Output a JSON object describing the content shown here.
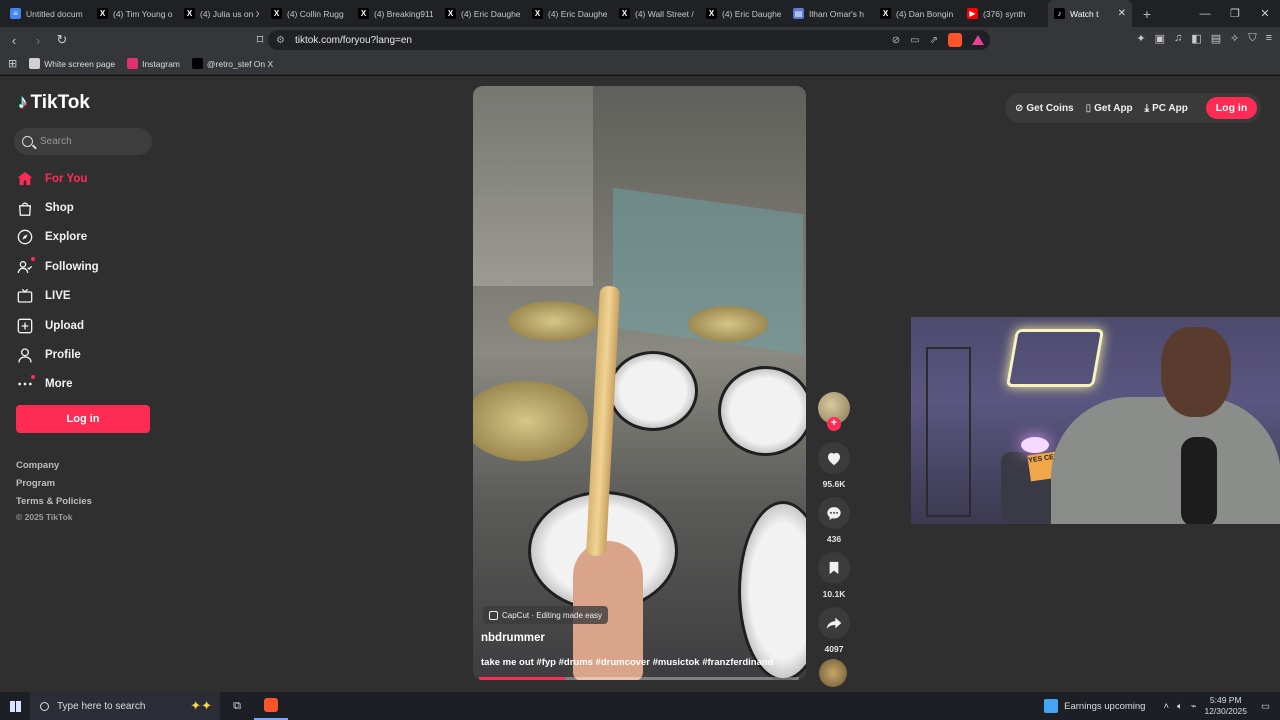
{
  "browser": {
    "tabs": [
      {
        "title": "Untitled docum",
        "icon": "docs-icon",
        "color": "#4285f4",
        "glyph": "≡"
      },
      {
        "title": "(4) Tim Young o",
        "icon": "x-icon",
        "color": "#000000",
        "glyph": "X"
      },
      {
        "title": "(4) Julia us on X",
        "icon": "x-icon",
        "color": "#000000",
        "glyph": "X"
      },
      {
        "title": "(4) Collin Rugg",
        "icon": "x-icon",
        "color": "#000000",
        "glyph": "X"
      },
      {
        "title": "(4) Breaking911",
        "icon": "x-icon",
        "color": "#000000",
        "glyph": "X"
      },
      {
        "title": "(4) Eric Daughe",
        "icon": "x-icon",
        "color": "#000000",
        "glyph": "X"
      },
      {
        "title": "(4) Eric Daughe",
        "icon": "x-icon",
        "color": "#000000",
        "glyph": "X"
      },
      {
        "title": "(4) Wall Street /",
        "icon": "x-icon",
        "color": "#000000",
        "glyph": "X"
      },
      {
        "title": "(4) Eric Daughe",
        "icon": "x-icon",
        "color": "#000000",
        "glyph": "X"
      },
      {
        "title": "Ilhan Omar's h",
        "icon": "news-icon",
        "color": "#5b7bd5",
        "glyph": "▤"
      },
      {
        "title": "(4) Dan Bongin",
        "icon": "x-icon",
        "color": "#000000",
        "glyph": "X"
      },
      {
        "title": "(376) synth",
        "icon": "youtube-icon",
        "color": "#ff0000",
        "glyph": "▶"
      },
      {
        "title": "Watch t",
        "icon": "tiktok-icon",
        "color": "#000000",
        "glyph": "♪",
        "active": true
      }
    ],
    "url": "tiktok.com/foryou?lang=en",
    "bookmarks": [
      {
        "label": "White screen page",
        "icon": "page-icon",
        "color": "#d0d0d0"
      },
      {
        "label": "Instagram",
        "icon": "instagram-icon",
        "color": "#e1306c"
      },
      {
        "label": "@retro_stef On X",
        "icon": "x-icon",
        "color": "#000000"
      }
    ]
  },
  "sidebar": {
    "logo": "TikTok",
    "search_placeholder": "Search",
    "items": [
      {
        "label": "For You",
        "icon": "home-icon",
        "active": true
      },
      {
        "label": "Shop",
        "icon": "shop-icon"
      },
      {
        "label": "Explore",
        "icon": "compass-icon"
      },
      {
        "label": "Following",
        "icon": "following-icon",
        "dot": true
      },
      {
        "label": "LIVE",
        "icon": "live-icon"
      },
      {
        "label": "Upload",
        "icon": "upload-icon"
      },
      {
        "label": "Profile",
        "icon": "profile-icon"
      },
      {
        "label": "More",
        "icon": "more-icon",
        "dot": true
      }
    ],
    "login_label": "Log in",
    "footer": {
      "company": "Company",
      "program": "Program",
      "terms": "Terms & Policies",
      "copyright": "© 2025 TikTok"
    }
  },
  "video": {
    "capcut_label": "CapCut · Editing made easy",
    "author": "nbdrummer",
    "description": "take me out #fyp #drums #drumcover #musictok #franzferdinand",
    "progress": 0.27
  },
  "actions": {
    "likes": "95.6K",
    "comments": "436",
    "saves": "10.1K",
    "shares": "4097"
  },
  "topbar": {
    "get_coins": "Get Coins",
    "get_app": "Get App",
    "pc_app": "PC App",
    "login": "Log in"
  },
  "webcam": {
    "pillow_text": "YES CERS"
  },
  "taskbar": {
    "search_placeholder": "Type here to search",
    "weather": "Earnings upcoming",
    "time": "5:49 PM",
    "date": "12/30/2025"
  },
  "colors": {
    "accent": "#fe2c55",
    "page_bg": "#2f2f2f"
  }
}
